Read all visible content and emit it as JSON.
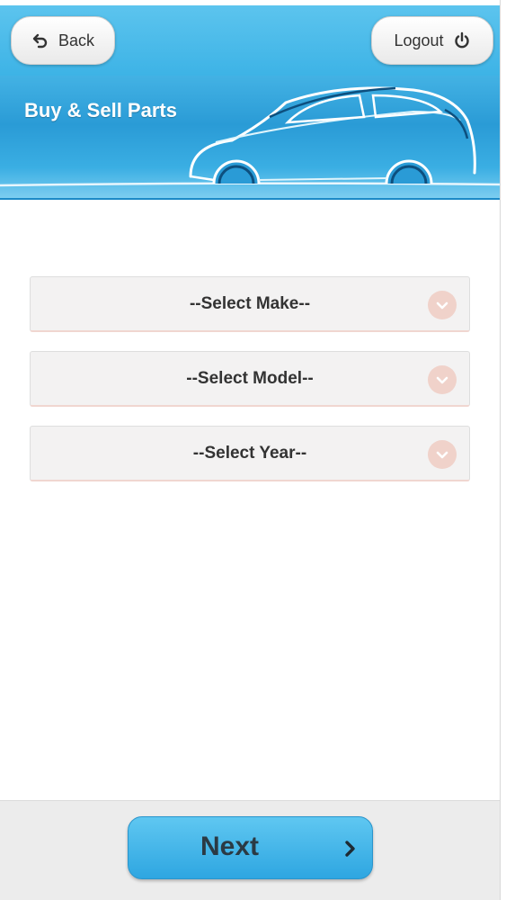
{
  "header": {
    "back_label": "Back",
    "logout_label": "Logout",
    "back_icon": "undo-arrow-icon",
    "logout_icon": "power-icon"
  },
  "banner": {
    "title": "Buy & Sell Parts"
  },
  "form": {
    "make": {
      "selected": "--Select Make--"
    },
    "model": {
      "selected": "--Select Model--"
    },
    "year": {
      "selected": "--Select Year--"
    }
  },
  "footer": {
    "next_label": "Next",
    "next_icon": "chevron-right-icon"
  },
  "colors": {
    "header_blue": "#3db3e6",
    "banner_blue": "#2a9bd6",
    "select_bg": "#f3f2f2",
    "chevron_bg": "#f0d2ca"
  }
}
